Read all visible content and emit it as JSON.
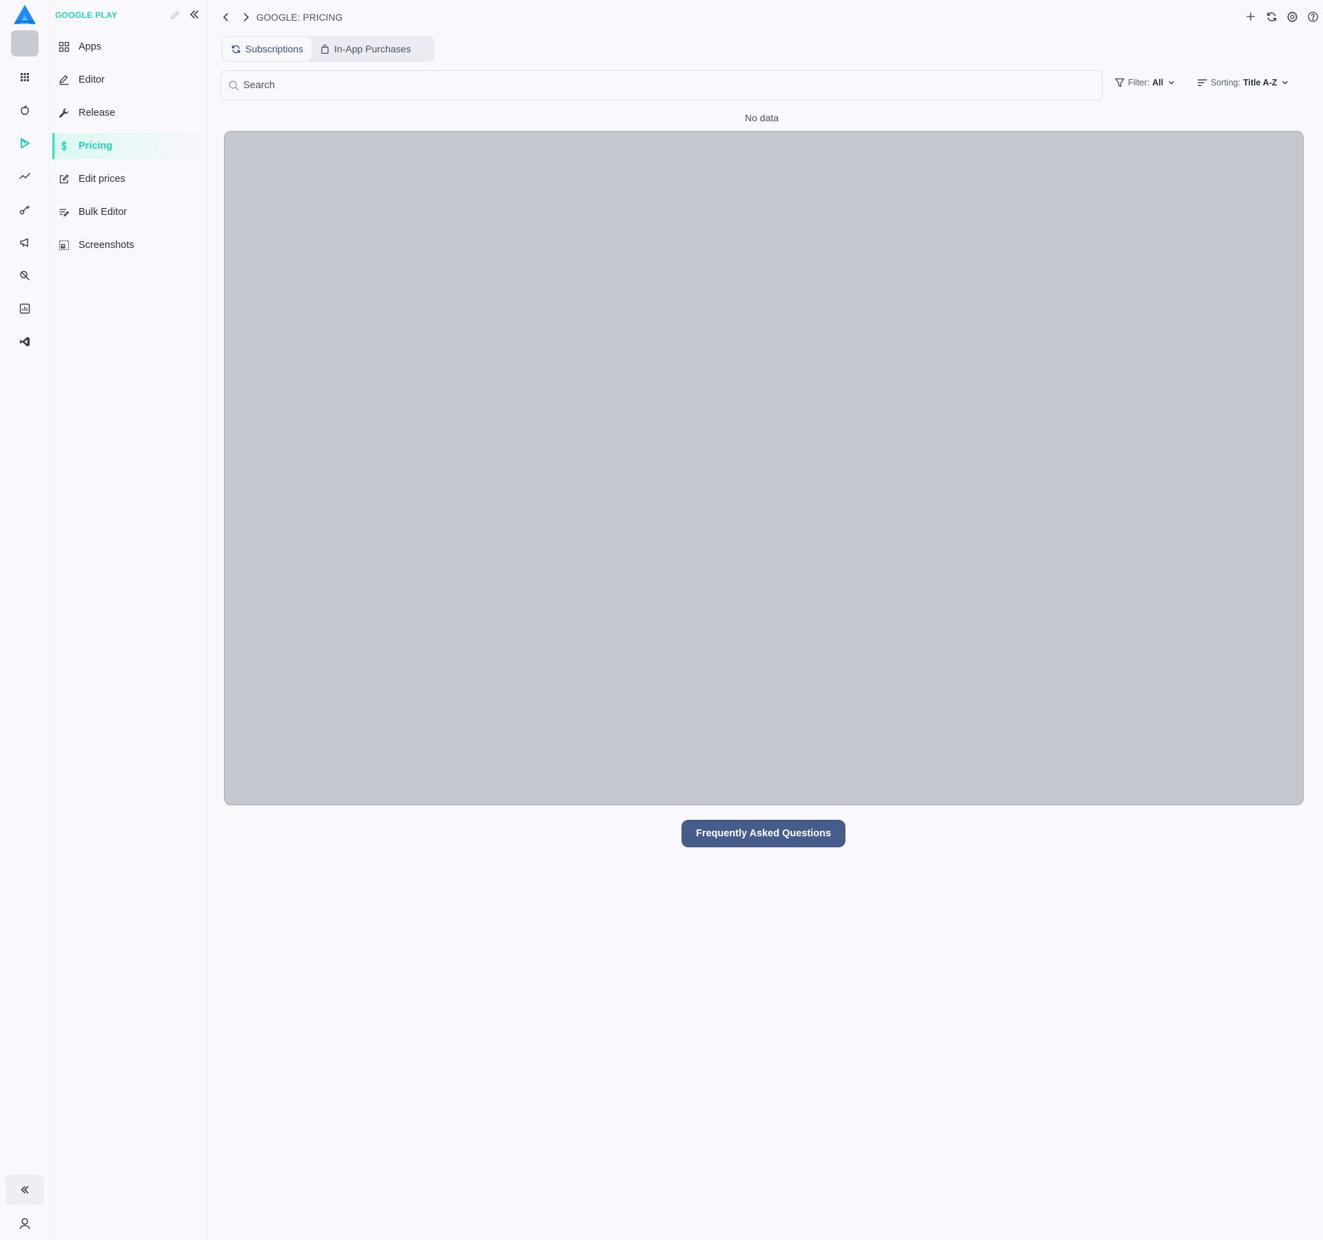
{
  "colors": {
    "accent": "#2ee6c1",
    "accent_text": "#1fd3b3",
    "primary_button": "#465c8b",
    "placeholder_box": "#c4c7cf",
    "background": "#f8f8fd"
  },
  "rail": {
    "logo_icon": "triangle-logo",
    "items": [
      {
        "icon": "apps-grid-icon"
      },
      {
        "icon": "apple-icon"
      },
      {
        "icon": "google-play-icon",
        "active": true
      },
      {
        "icon": "trend-line-icon"
      },
      {
        "icon": "key-icon"
      },
      {
        "icon": "megaphone-icon"
      },
      {
        "icon": "search-tool-icon"
      },
      {
        "icon": "bar-chart-icon"
      },
      {
        "icon": "vscode-icon"
      }
    ],
    "bottom": [
      {
        "icon": "double-chevron-left-icon"
      },
      {
        "icon": "user-icon"
      }
    ]
  },
  "nav": {
    "title": "GOOGLE PLAY",
    "items": [
      {
        "label": "Apps",
        "icon": "grid-icon"
      },
      {
        "label": "Editor",
        "icon": "pencil-icon"
      },
      {
        "label": "Release",
        "icon": "wrench-icon"
      },
      {
        "label": "Pricing",
        "icon": "dollar-icon",
        "active": true
      },
      {
        "label": "Edit prices",
        "icon": "edit-box-icon"
      },
      {
        "label": "Bulk Editor",
        "icon": "list-edit-icon"
      },
      {
        "label": "Screenshots",
        "icon": "screenshot-icon"
      }
    ]
  },
  "header": {
    "breadcrumb": "GOOGLE: PRICING",
    "actions": [
      "plus-icon",
      "refresh-icon",
      "gear-icon",
      "help-icon"
    ]
  },
  "tabs": [
    {
      "label": "Subscriptions",
      "icon": "refresh-icon",
      "active": true
    },
    {
      "label": "In-App Purchases",
      "icon": "shopping-bag-icon",
      "active": false
    }
  ],
  "search": {
    "placeholder": "Search",
    "value": ""
  },
  "filter": {
    "label": "Filter:",
    "value": "All"
  },
  "sorting": {
    "label": "Sorting:",
    "value": "Title A-Z"
  },
  "content": {
    "empty_text": "No data"
  },
  "faq_button": {
    "label": "Frequently Asked Questions"
  }
}
